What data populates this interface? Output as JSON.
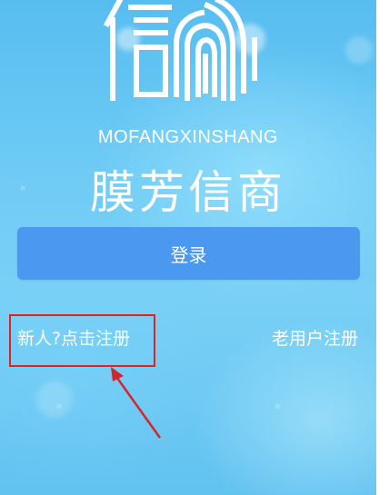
{
  "brand": {
    "english_name": "MOFANGXINSHANG",
    "chinese_name": "膜芳信商"
  },
  "actions": {
    "login_label": "登录",
    "new_user_register": "新人?点击注册",
    "existing_user_register": "老用户注册"
  },
  "colors": {
    "background": "#62c2f0",
    "login_button": "#4a98f0",
    "highlight_box": "#e2231a",
    "annotation_arrow": "#d8232a",
    "text": "#ffffff"
  },
  "icons": {
    "logo": "fingerprint-xin-logo",
    "annotation": "arrow-up-left-icon"
  }
}
